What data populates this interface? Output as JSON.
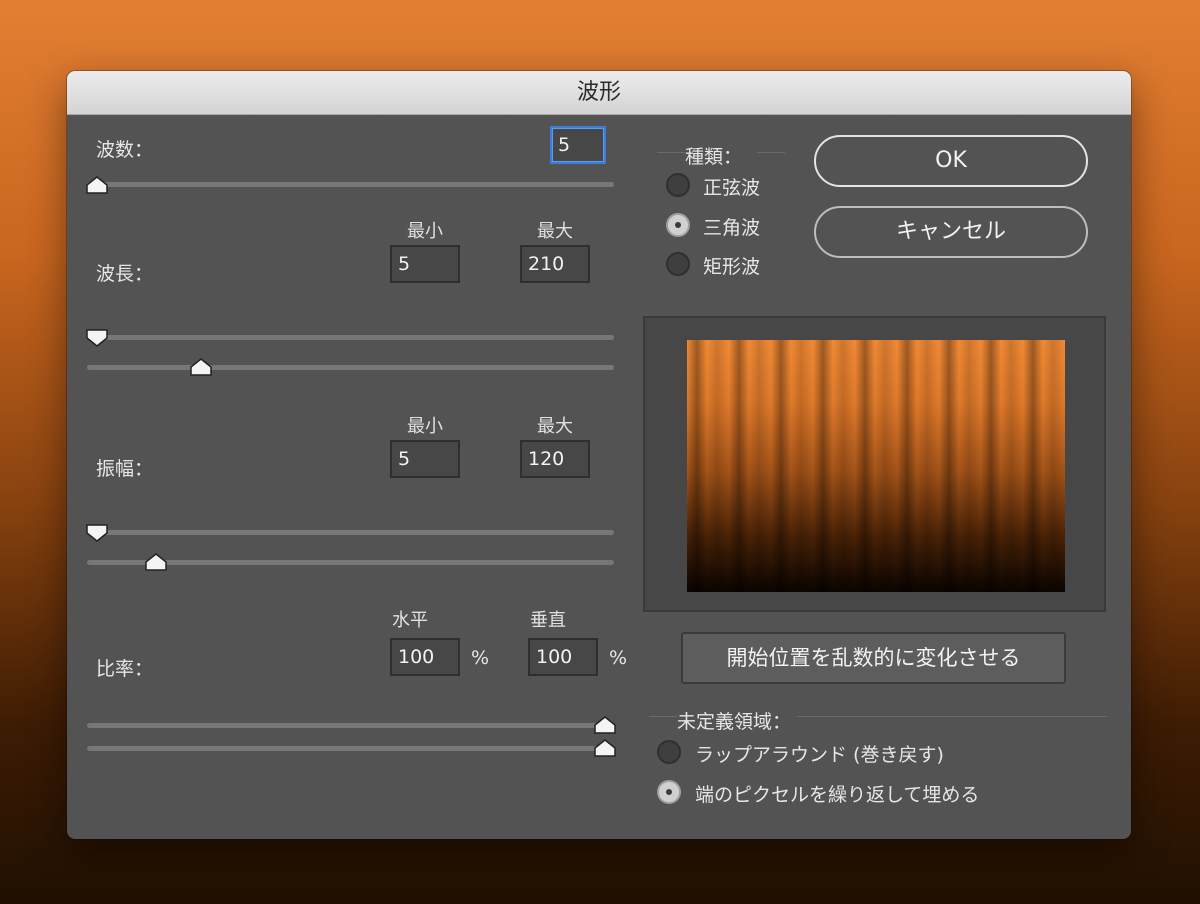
{
  "window": {
    "title": "波形"
  },
  "generators": {
    "label": "波数：",
    "value": "5"
  },
  "wavelength": {
    "label": "波長：",
    "min_header": "最小",
    "max_header": "最大",
    "min_value": "5",
    "max_value": "210"
  },
  "amplitude": {
    "label": "振幅：",
    "min_header": "最小",
    "max_header": "最大",
    "min_value": "5",
    "max_value": "120"
  },
  "scale": {
    "label": "比率：",
    "horizontal_header": "水平",
    "vertical_header": "垂直",
    "horizontal_value": "100",
    "vertical_value": "100",
    "unit": "%"
  },
  "type": {
    "label": "種類：",
    "options": [
      {
        "label": "正弦波",
        "selected": false
      },
      {
        "label": "三角波",
        "selected": true
      },
      {
        "label": "矩形波",
        "selected": false
      }
    ]
  },
  "buttons": {
    "ok": "OK",
    "cancel": "キャンセル",
    "randomize": "開始位置を乱数的に変化させる"
  },
  "undefined_areas": {
    "label": "未定義領域：",
    "options": [
      {
        "label": "ラップアラウンド (巻き戻す)",
        "selected": false
      },
      {
        "label": "端のピクセルを繰り返して埋める",
        "selected": true
      }
    ]
  },
  "sliders": {
    "generators": 0.0,
    "wavelength_min": 0.0,
    "wavelength_max": 0.21,
    "amplitude_min": 0.0,
    "amplitude_max": 0.12,
    "scale_horizontal": 1.0,
    "scale_vertical": 1.0
  },
  "colors": {
    "focus": "#3b7ddd",
    "preview_top": "#f28a35",
    "preview_bottom": "#0a0400"
  }
}
